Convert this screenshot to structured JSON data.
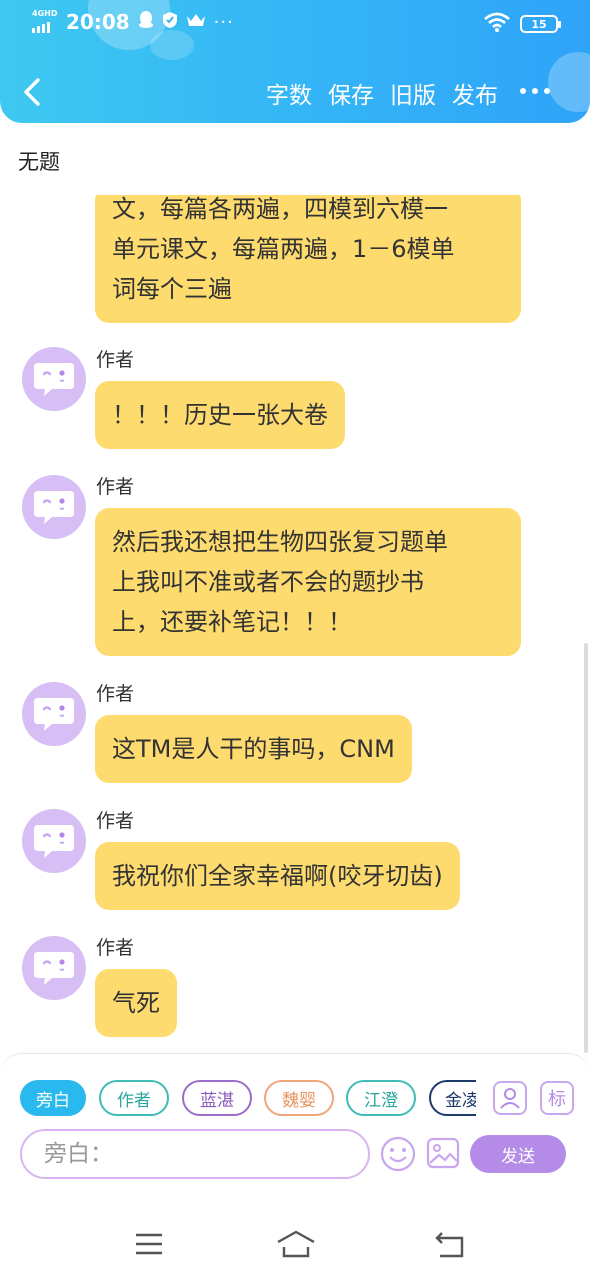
{
  "status_bar": {
    "network": "4GHD",
    "time": "20:08",
    "battery": "15"
  },
  "nav": {
    "actions": [
      "字数",
      "保存",
      "旧版",
      "发布"
    ]
  },
  "document": {
    "title": "无题"
  },
  "messages": [
    {
      "text_lines": [
        "文，每篇各两遍，四模到六模一",
        "单元课文，每篇两遍，1－6模单",
        "词每个三遍"
      ]
    },
    {
      "author": "作者",
      "text_lines": [
        "！！！历史一张大卷"
      ]
    },
    {
      "author": "作者",
      "text_lines": [
        "然后我还想把生物四张复习题单",
        "上我叫不准或者不会的题抄书",
        "上，还要补笔记！！！"
      ]
    },
    {
      "author": "作者",
      "text_lines": [
        "这TM是人干的事吗，CNM"
      ]
    },
    {
      "author": "作者",
      "text_lines": [
        "我祝你们全家幸福啊(咬牙切齿)"
      ]
    },
    {
      "author": "作者",
      "text_lines": [
        "气死"
      ]
    }
  ],
  "characters": [
    {
      "label": "旁白",
      "active": true,
      "color": "#29b9ee"
    },
    {
      "label": "作者",
      "active": false,
      "color": "#3fbcb7"
    },
    {
      "label": "蓝湛",
      "active": false,
      "color": "#9b6dc9"
    },
    {
      "label": "魏婴",
      "active": false,
      "color": "#f0a67a"
    },
    {
      "label": "江澄",
      "active": false,
      "color": "#3fbcb7"
    },
    {
      "label": "金凌",
      "active": false,
      "color": "#1d3a6b"
    }
  ],
  "toolbar": {
    "tag_label": "标",
    "input_placeholder": "旁白：",
    "send_label": "发送"
  }
}
